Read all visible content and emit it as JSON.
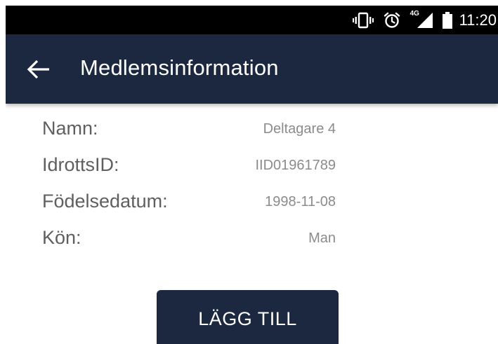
{
  "status_bar": {
    "time": "11:20",
    "network_label": "4G",
    "icons": [
      "vibrate-icon",
      "alarm-icon",
      "signal-4g-icon",
      "battery-icon"
    ]
  },
  "app_bar": {
    "back_icon": "arrow-back-icon",
    "title": "Medlemsinformation"
  },
  "member": {
    "rows": [
      {
        "label": "Namn:",
        "value": "Deltagare 4"
      },
      {
        "label": "IdrottsID:",
        "value": "IID01961789"
      },
      {
        "label": "Födelsedatum:",
        "value": "1998-11-08"
      },
      {
        "label": "Kön:",
        "value": "Man"
      }
    ]
  },
  "actions": {
    "add_label": "LÄGG TILL"
  },
  "colors": {
    "primary": "#1c2840",
    "status_bar": "#000000",
    "label_text": "#5f5f5f",
    "value_text": "#8b8b8b"
  }
}
